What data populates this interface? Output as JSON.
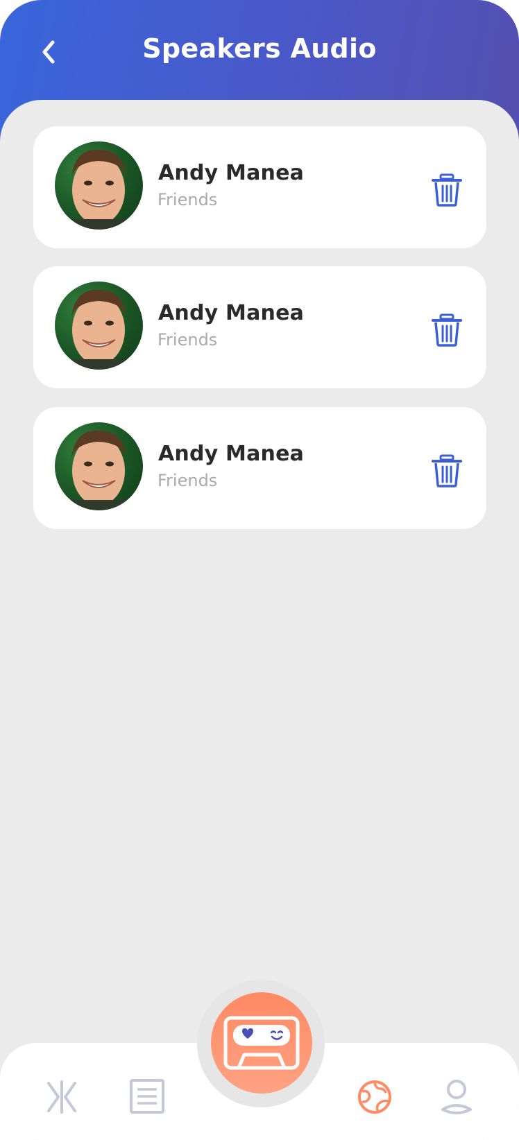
{
  "header": {
    "title": "Speakers Audio"
  },
  "speakers": [
    {
      "name": "Andy Manea",
      "group": "Friends"
    },
    {
      "name": "Andy Manea",
      "group": "Friends"
    },
    {
      "name": "Andy Manea",
      "group": "Friends"
    }
  ],
  "tabbar": {
    "tabs": [
      {
        "icon": "xk-logo-icon",
        "active": false
      },
      {
        "icon": "list-icon",
        "active": false
      },
      {
        "icon": "cassette-icon",
        "active": false
      },
      {
        "icon": "globe-icon",
        "active": true
      },
      {
        "icon": "profile-icon",
        "active": false
      }
    ]
  },
  "colors": {
    "header_gradient_start": "#3a66dc",
    "header_gradient_end": "#5550b0",
    "accent_blue": "#3a5fd6",
    "accent_orange": "#ff8a63",
    "inactive_icon": "#c5c8d8",
    "background": "#ebebeb"
  }
}
